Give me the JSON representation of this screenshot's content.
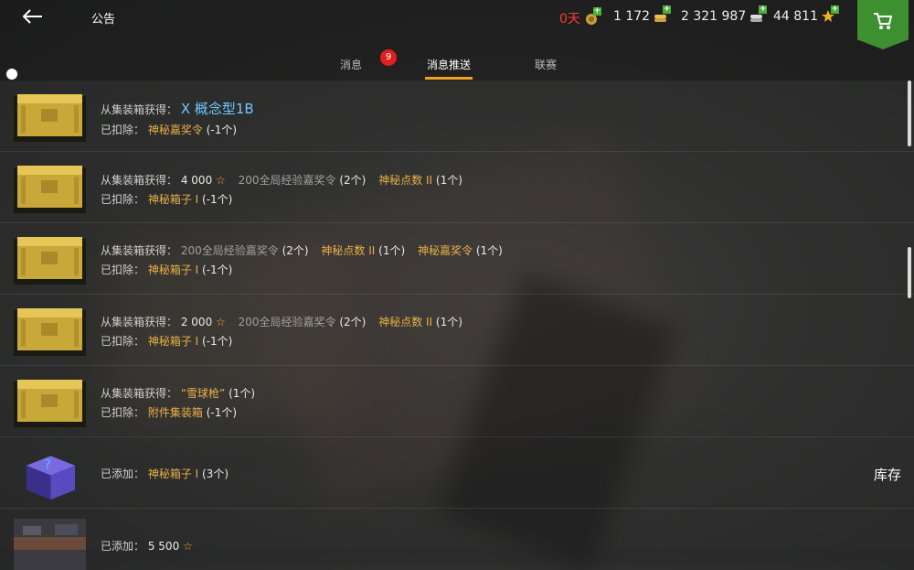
{
  "header": {
    "title": "公告"
  },
  "resources": [
    {
      "value": "0天",
      "color": "#ff3b2f",
      "icon": "vip-badge-icon"
    },
    {
      "value": "1 172",
      "color": "#eeeeee",
      "icon": "gold-coin-icon"
    },
    {
      "value": "2 321 987",
      "color": "#eeeeee",
      "icon": "silver-coin-icon"
    },
    {
      "value": "44 811",
      "color": "#eeeeee",
      "icon": "star-icon"
    }
  ],
  "tabs": [
    {
      "label": "消息",
      "badge": "9"
    },
    {
      "label": "消息推送"
    },
    {
      "label": "联赛"
    }
  ],
  "rows": [
    {
      "l1": "从集装箱获得：",
      "l1_item": "X 概念型1B",
      "l2": "已扣除：",
      "l2_item": "神秘嘉奖令",
      "l2_qty": "(-1个)"
    },
    {
      "l1": "从集装箱获得：",
      "v1": "4 000",
      "i1": "200全局经验嘉奖令",
      "q1": "(2个)",
      "i2": "神秘点数 II",
      "q2": "(1个)",
      "l2": "已扣除：",
      "l2_item": "神秘箱子 I",
      "l2_qty": "(-1个)"
    },
    {
      "l1": "从集装箱获得：",
      "i1": "200全局经验嘉奖令",
      "q1": "(2个)",
      "i2": "神秘点数 II",
      "q2": "(1个)",
      "i3": "神秘嘉奖令",
      "q3": "(1个)",
      "l2": "已扣除：",
      "l2_item": "神秘箱子 I",
      "l2_qty": "(-1个)"
    },
    {
      "l1": "从集装箱获得：",
      "v1": "2 000",
      "i1": "200全局经验嘉奖令",
      "q1": "(2个)",
      "i2": "神秘点数 II",
      "q2": "(1个)",
      "l2": "已扣除：",
      "l2_item": "神秘箱子 I",
      "l2_qty": "(-1个)"
    },
    {
      "l1": "从集装箱获得：",
      "i1": "“雪球枪”",
      "q1": "(1个)",
      "l2": "已扣除：",
      "l2_item": "附件集装箱",
      "l2_qty": "(-1个)"
    },
    {
      "l1": "已添加：",
      "i1": "神秘箱子 I",
      "q1": "(3个)",
      "action": "库存"
    },
    {
      "l1": "已添加：",
      "v1": "5 500"
    }
  ]
}
